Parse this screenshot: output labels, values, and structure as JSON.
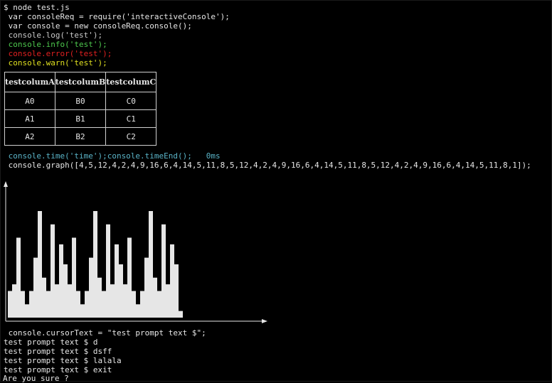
{
  "terminal": {
    "command": "$ node test.js",
    "lines": {
      "require": " var consoleReq = require('interactiveConsole');",
      "init": " var console = new consoleReq.console();",
      "log": " console.log('test');",
      "info": " console.info('test');",
      "error": " console.error('test');",
      "warn": " console.warn('test');",
      "time": " console.time('time');console.timeEnd();   0ms",
      "graph": " console.graph([4,5,12,4,2,4,9,16,6,4,14,5,11,8,5,12,4,2,4,9,16,6,4,14,5,11,8,5,12,4,2,4,9,16,6,4,14,5,11,8,1]);",
      "cursor": " console.cursorText = \"test prompt text $\";",
      "p1": "test prompt text $ d",
      "p2": "test prompt text $ dsff",
      "p3": "test prompt text $ lalala",
      "p4": "test prompt text $ exit",
      "confirm": "Are you sure ?"
    },
    "colors": {
      "log": "#c9c9c9",
      "info": "#4ec94e",
      "error": "#e02020",
      "warn": "#e0e020",
      "time": "#5ab4c8"
    }
  },
  "table": {
    "headers": [
      "testcolumA",
      "testcolumB",
      "testcolumC"
    ],
    "rows": [
      [
        "A0",
        "B0",
        "C0"
      ],
      [
        "A1",
        "B1",
        "C1"
      ],
      [
        "A2",
        "B2",
        "C2"
      ]
    ]
  },
  "chart_data": {
    "type": "bar",
    "values": [
      4,
      5,
      12,
      4,
      2,
      4,
      9,
      16,
      6,
      4,
      14,
      5,
      11,
      8,
      5,
      12,
      4,
      2,
      4,
      9,
      16,
      6,
      4,
      14,
      5,
      11,
      8,
      5,
      12,
      4,
      2,
      4,
      9,
      16,
      6,
      4,
      14,
      5,
      11,
      8,
      1
    ],
    "ylim": [
      0,
      16
    ],
    "grid": false,
    "bar_color": "#e6e6e6"
  }
}
